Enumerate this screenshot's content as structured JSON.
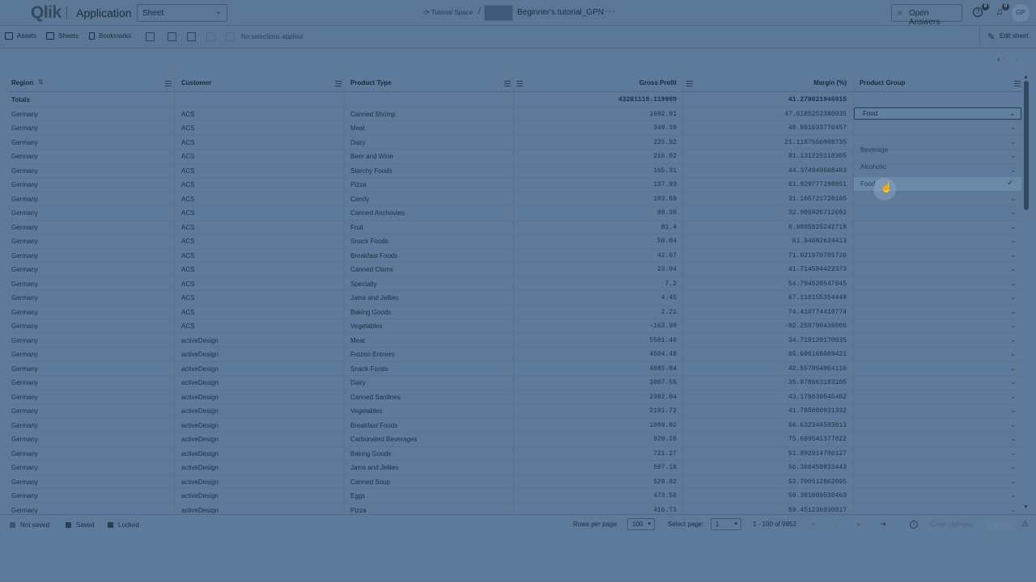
{
  "header": {
    "logo": "Qlik",
    "app_title": "Application",
    "sheet_select": "Sheet",
    "space": "Tutorial Space",
    "separator": "/",
    "app_name": "Beginner's tutorial_GPN",
    "more": "···",
    "open_answers": "Open Answers",
    "help_badge": "8",
    "notif_badge": "8",
    "avatar": "GP"
  },
  "toolbar": {
    "assets": "Assets",
    "sheets": "Sheets",
    "bookmarks": "Bookmarks",
    "no_selections": "No selections applied",
    "edit_sheet": "Edit sheet"
  },
  "table": {
    "columns": [
      "Region",
      "Customer",
      "Product Type",
      "Gross Profit",
      "Margin (%)",
      "Product Group"
    ],
    "totals": {
      "label": "Totals",
      "gross_profit": "43281110.119999",
      "margin": "41.278021946915"
    },
    "rows": [
      [
        "Germany",
        "ACS",
        "Canned Shrimp",
        "1692.91",
        "47.6185252380035"
      ],
      [
        "Germany",
        "ACS",
        "Meat",
        "349.39",
        "48.881633776457"
      ],
      [
        "Germany",
        "ACS",
        "Dairy",
        "225.92",
        "21.1187556008735"
      ],
      [
        "Germany",
        "ACS",
        "Beer and Wine",
        "216.02",
        "81.131225118305"
      ],
      [
        "Germany",
        "ACS",
        "Starchy Foods",
        "165.31",
        "44.374949668483"
      ],
      [
        "Germany",
        "ACS",
        "Pizza",
        "137.93",
        "61.929777298851"
      ],
      [
        "Germany",
        "ACS",
        "Candy",
        "103.89",
        "31.105721728105"
      ],
      [
        "Germany",
        "ACS",
        "Canned Anchovies",
        "99.38",
        "32.985926712692"
      ],
      [
        "Germany",
        "ACS",
        "Fruit",
        "81.4",
        "8.9805825242718"
      ],
      [
        "Germany",
        "ACS",
        "Snack Foods",
        "50.04",
        "61.94602624413"
      ],
      [
        "Germany",
        "ACS",
        "Breakfast Foods",
        "42.67",
        "71.021970705726"
      ],
      [
        "Germany",
        "ACS",
        "Canned Clams",
        "23.94",
        "41.714584422373"
      ],
      [
        "Germany",
        "ACS",
        "Specialty",
        "7.2",
        "54.794520547945"
      ],
      [
        "Germany",
        "ACS",
        "Jams and Jellies",
        "4.45",
        "67.110155354449"
      ],
      [
        "Germany",
        "ACS",
        "Baking Goods",
        "2.21",
        "74.410774410774"
      ],
      [
        "Germany",
        "ACS",
        "Vegetables",
        "-163.99",
        "-92.258790436006"
      ],
      [
        "Germany",
        "activeDesign",
        "Meat",
        "5591.49",
        "34.719120170035"
      ],
      [
        "Germany",
        "activeDesign",
        "Frozen Entrees",
        "4504.48",
        "65.606166089421"
      ],
      [
        "Germany",
        "activeDesign",
        "Snack Foods",
        "4085.84",
        "42.557864064116"
      ],
      [
        "Germany",
        "activeDesign",
        "Dairy",
        "3007.55",
        "35.978663183105"
      ],
      [
        "Germany",
        "activeDesign",
        "Canned Sardines",
        "2392.04",
        "43.178630545482"
      ],
      [
        "Germany",
        "activeDesign",
        "Vegetables",
        "2191.72",
        "41.785880931332"
      ],
      [
        "Germany",
        "activeDesign",
        "Breakfast Foods",
        "1009.92",
        "66.632344593613"
      ],
      [
        "Germany",
        "activeDesign",
        "Carbonated Beverages",
        "929.28",
        "75.699541377822"
      ],
      [
        "Germany",
        "activeDesign",
        "Baking Goods",
        "721.27",
        "51.892914700127"
      ],
      [
        "Germany",
        "activeDesign",
        "Jams and Jellies",
        "597.18",
        "56.366450833443"
      ],
      [
        "Germany",
        "activeDesign",
        "Canned Soup",
        "529.82",
        "53.700512862095"
      ],
      [
        "Germany",
        "activeDesign",
        "Eggs",
        "473.56",
        "59.301000538463"
      ],
      [
        "Germany",
        "activeDesign",
        "Pizza",
        "416.73",
        "59.451236930817"
      ]
    ]
  },
  "dropdown": {
    "value": "Food",
    "options": [
      "Beverage",
      "Alcoholic",
      "Food"
    ],
    "selected": "Food"
  },
  "footer": {
    "legend": [
      "Not saved",
      "Saved",
      "Locked"
    ],
    "rows_per_page_label": "Rows per page:",
    "rows_per_page": "100",
    "select_page_label": "Select page:",
    "page": "1",
    "range": "1 - 100 of 9952",
    "clear_changes": "Clear changes",
    "save": "Save"
  }
}
